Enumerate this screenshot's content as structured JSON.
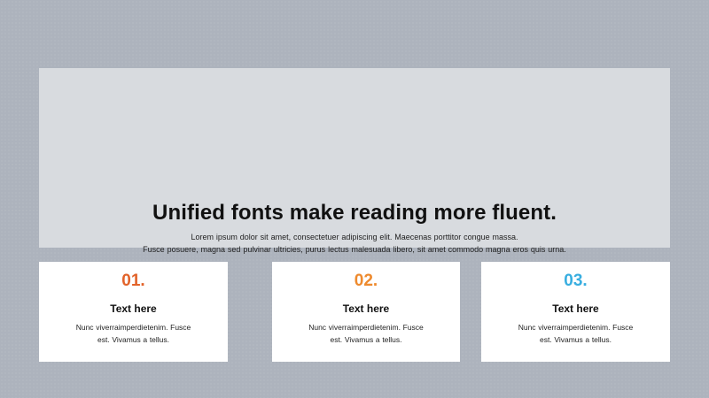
{
  "hero": {
    "title": "Unified fonts make reading more fluent.",
    "lines": [
      "Lorem ipsum dolor sit amet, consectetuer adipiscing elit. Maecenas porttitor congue massa.",
      "Fusce posuere, magna sed pulvinar ultricies, purus lectus malesuada libero, sit amet commodo magna eros quis urna."
    ]
  },
  "cards": [
    {
      "number": "01.",
      "accent": "#e2632a",
      "heading": "Text here",
      "lines": [
        "Nunc viverraimperdietenim. Fusce",
        "est. Vivamus a tellus."
      ]
    },
    {
      "number": "02.",
      "accent": "#ee8a2e",
      "heading": "Text here",
      "lines": [
        "Nunc viverraimperdietenim. Fusce",
        "est. Vivamus a tellus."
      ]
    },
    {
      "number": "03.",
      "accent": "#38aee0",
      "heading": "Text here",
      "lines": [
        "Nunc viverraimperdietenim. Fusce",
        "est. Vivamus a tellus."
      ]
    }
  ],
  "colors": {
    "background": "#adb3bd",
    "hero_panel": "#d8dbdf",
    "card": "#ffffff"
  }
}
